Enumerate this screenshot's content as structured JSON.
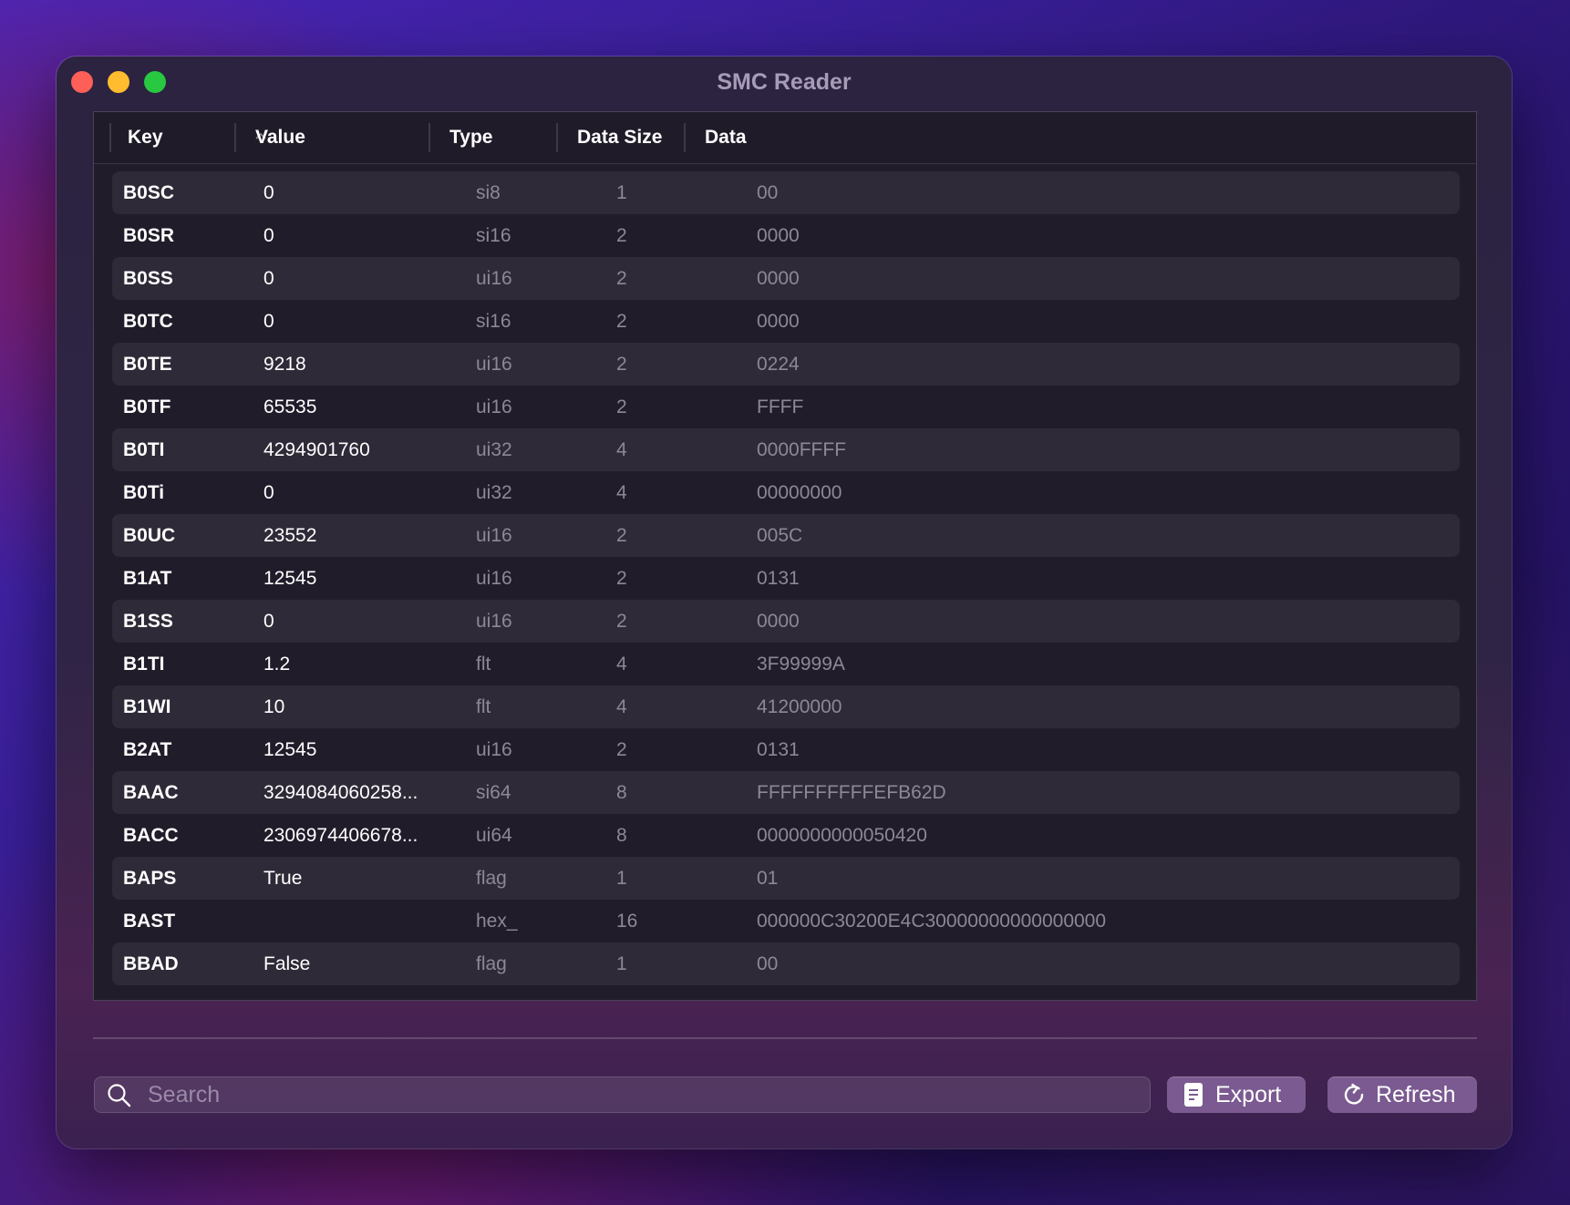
{
  "window": {
    "title": "SMC Reader"
  },
  "table": {
    "columns": [
      "Key",
      "Value",
      "Type",
      "Data Size",
      "Data"
    ],
    "sorted_column": "Key",
    "sort_direction": "ascending",
    "rows": [
      {
        "key": "B0SC",
        "value": "0",
        "type": "si8",
        "size": "1",
        "data": "00"
      },
      {
        "key": "B0SR",
        "value": "0",
        "type": "si16",
        "size": "2",
        "data": "0000"
      },
      {
        "key": "B0SS",
        "value": "0",
        "type": "ui16",
        "size": "2",
        "data": "0000"
      },
      {
        "key": "B0TC",
        "value": "0",
        "type": "si16",
        "size": "2",
        "data": "0000"
      },
      {
        "key": "B0TE",
        "value": "9218",
        "type": "ui16",
        "size": "2",
        "data": "0224"
      },
      {
        "key": "B0TF",
        "value": "65535",
        "type": "ui16",
        "size": "2",
        "data": "FFFF"
      },
      {
        "key": "B0TI",
        "value": "4294901760",
        "type": "ui32",
        "size": "4",
        "data": "0000FFFF"
      },
      {
        "key": "B0Ti",
        "value": "0",
        "type": "ui32",
        "size": "4",
        "data": "00000000"
      },
      {
        "key": "B0UC",
        "value": "23552",
        "type": "ui16",
        "size": "2",
        "data": "005C"
      },
      {
        "key": "B1AT",
        "value": "12545",
        "type": "ui16",
        "size": "2",
        "data": "0131"
      },
      {
        "key": "B1SS",
        "value": "0",
        "type": "ui16",
        "size": "2",
        "data": "0000"
      },
      {
        "key": "B1TI",
        "value": "1.2",
        "type": "flt",
        "size": "4",
        "data": "3F99999A"
      },
      {
        "key": "B1WI",
        "value": "10",
        "type": "flt",
        "size": "4",
        "data": "41200000"
      },
      {
        "key": "B2AT",
        "value": "12545",
        "type": "ui16",
        "size": "2",
        "data": "0131"
      },
      {
        "key": "BAAC",
        "value": "3294084060258...",
        "type": "si64",
        "size": "8",
        "data": "FFFFFFFFFFEFB62D"
      },
      {
        "key": "BACC",
        "value": "2306974406678...",
        "type": "ui64",
        "size": "8",
        "data": "0000000000050420"
      },
      {
        "key": "BAPS",
        "value": "True",
        "type": "flag",
        "size": "1",
        "data": "01"
      },
      {
        "key": "BAST",
        "value": "",
        "type": "hex_",
        "size": "16",
        "data": "000000C30200E4C30000000000000000"
      },
      {
        "key": "BBAD",
        "value": "False",
        "type": "flag",
        "size": "1",
        "data": "00"
      }
    ]
  },
  "search": {
    "placeholder": "Search",
    "value": "",
    "icon": "search-icon"
  },
  "toolbar": {
    "export_label": "Export",
    "export_icon": "document-icon",
    "refresh_label": "Refresh",
    "refresh_icon": "refresh-icon"
  },
  "colors": {
    "close": "#fe5f57",
    "minimize": "#febc2e",
    "zoom": "#28c840",
    "button_bg": "#7a5a90",
    "table_bg": "#201c2a",
    "row_alt_bg": "#2e2a37"
  }
}
